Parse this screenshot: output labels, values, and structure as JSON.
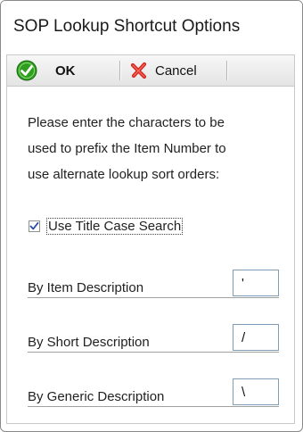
{
  "window": {
    "title": "SOP Lookup Shortcut Options"
  },
  "toolbar": {
    "ok_label": "OK",
    "cancel_label": "Cancel"
  },
  "instructions": {
    "lines": [
      "Please enter the characters to be",
      "used to prefix the Item Number to",
      "use alternate lookup sort orders:"
    ]
  },
  "title_case": {
    "label": "Use Title Case Search",
    "checked": true
  },
  "fields": [
    {
      "label": "By Item Description",
      "value": "'"
    },
    {
      "label": "By Short Description",
      "value": "/"
    },
    {
      "label": "By Generic Description",
      "value": "\\"
    }
  ],
  "colors": {
    "ok_green": "#2f9e1f",
    "cancel_red": "#d4241b",
    "check_blue": "#2a4fa8"
  },
  "icons": [
    "ok-checkmark-icon",
    "cancel-x-icon",
    "checkbox-check-icon"
  ]
}
